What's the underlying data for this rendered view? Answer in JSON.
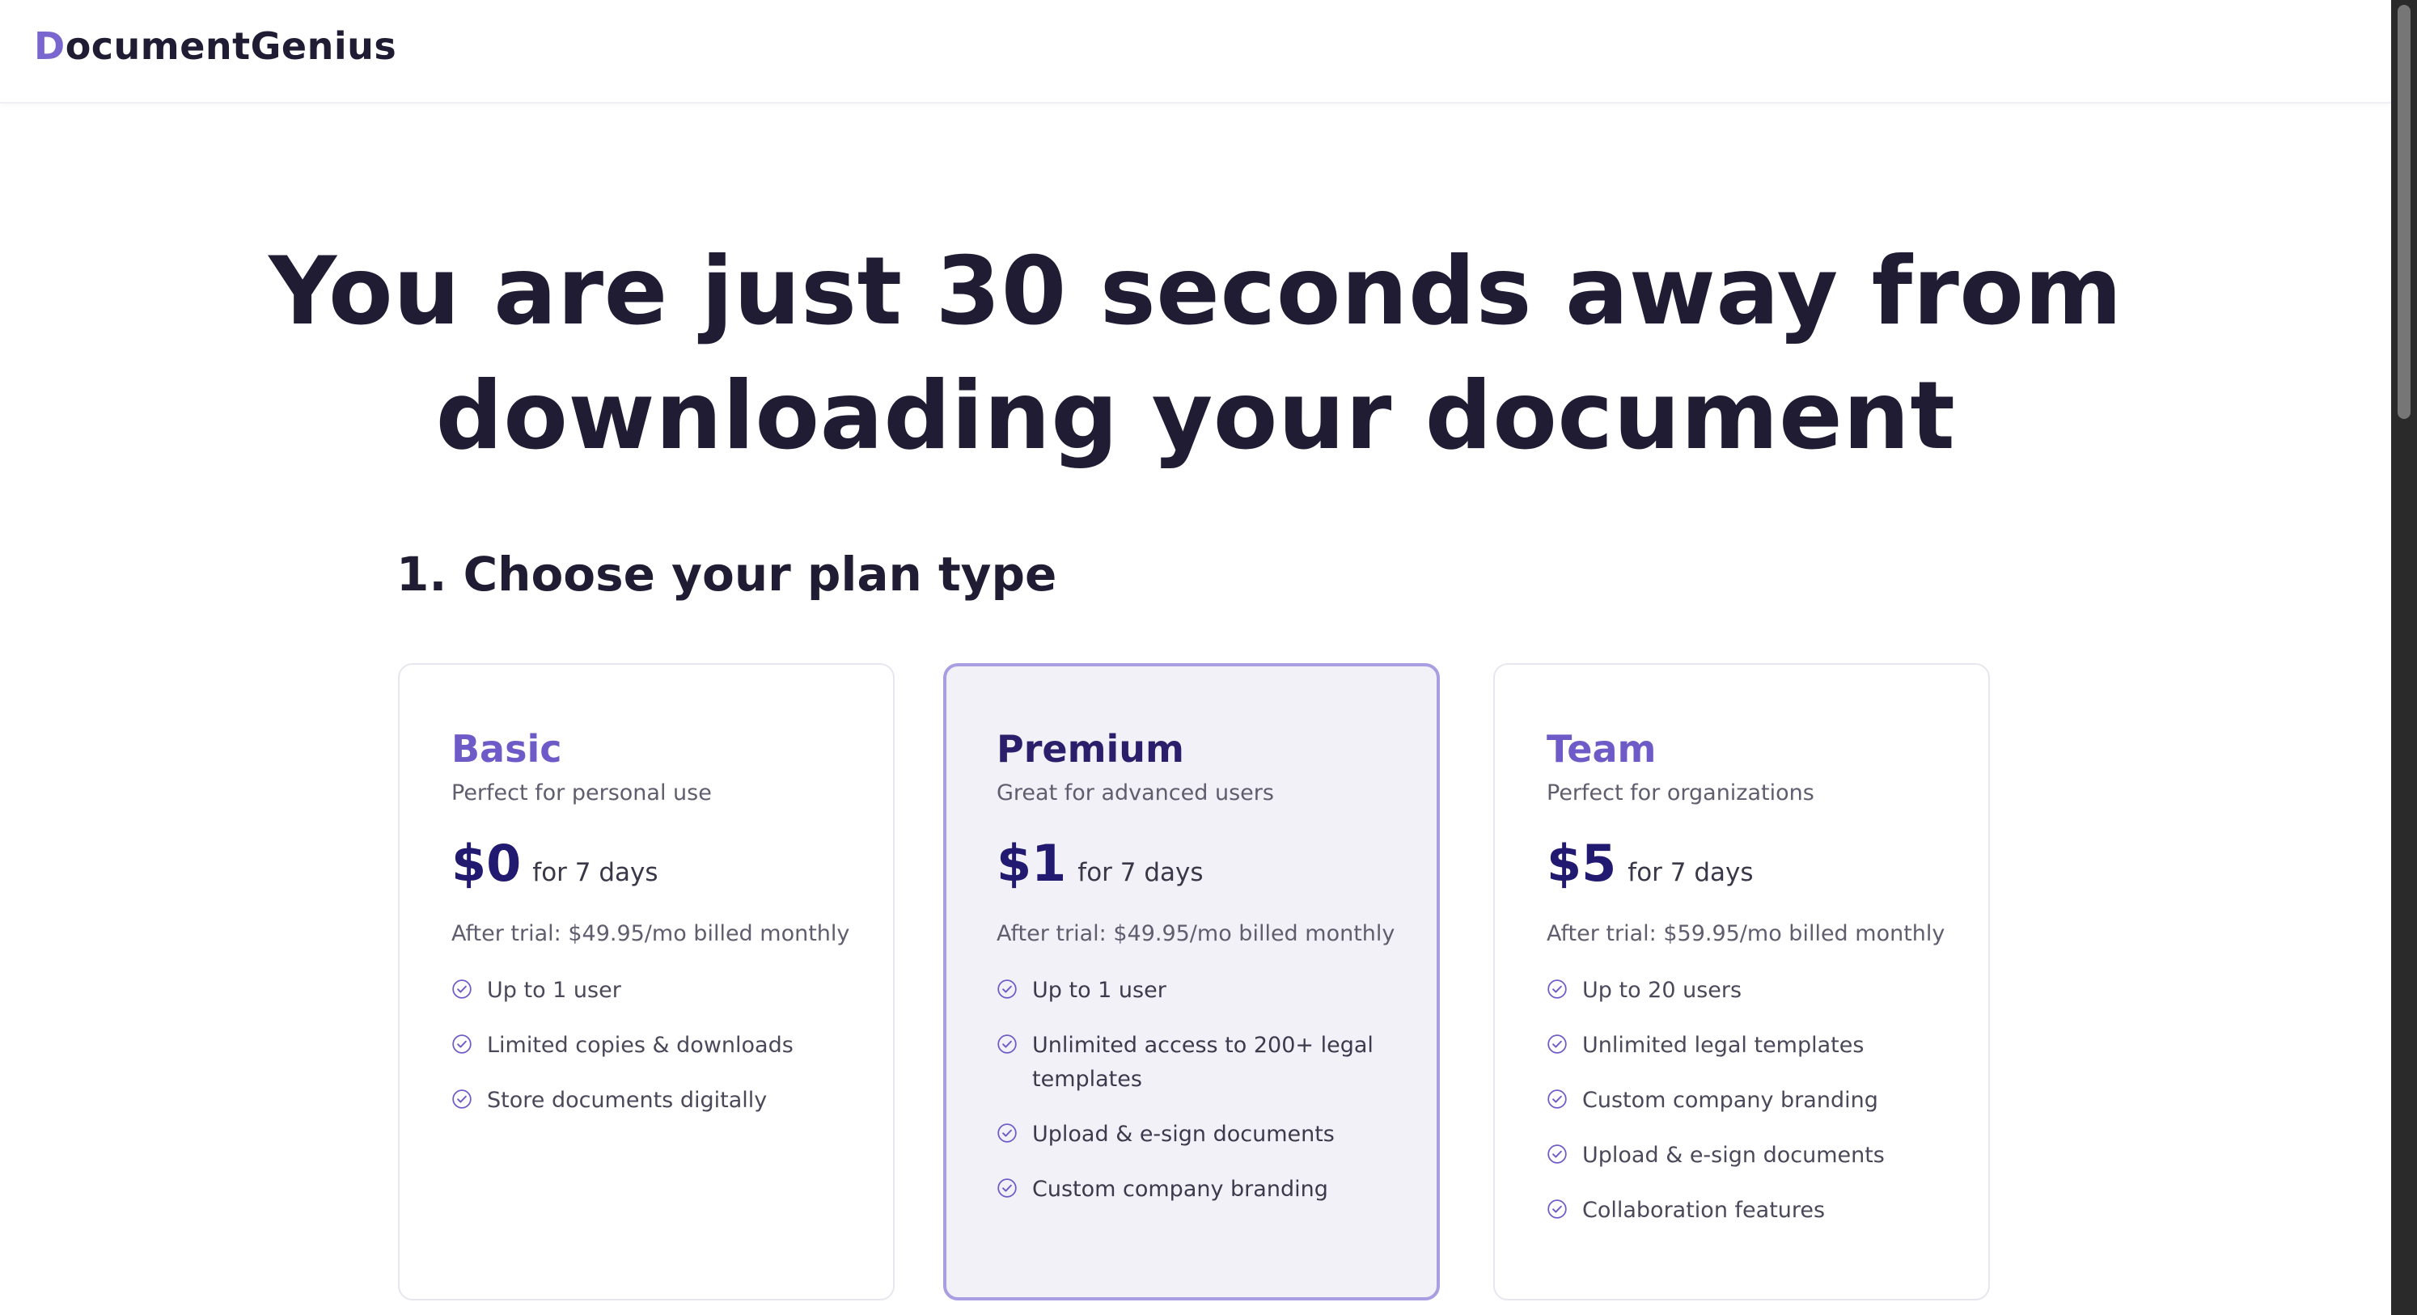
{
  "header": {
    "logo_initial": "D",
    "logo_rest": "ocumentGenius"
  },
  "hero": {
    "line1": "You are just 30 seconds away from",
    "line2": "downloading your document"
  },
  "section": {
    "title": "1. Choose your plan type"
  },
  "colors": {
    "accent": "#6e5bc8",
    "price": "#221a70",
    "selected_border": "#a99ee2",
    "selected_bg": "#f2f1f8"
  },
  "plans": [
    {
      "name": "Basic",
      "tagline": "Perfect for personal use",
      "price": "$0",
      "period": "for 7 days",
      "after_trial": "After trial: $49.95/mo billed monthly",
      "selected": false,
      "features": [
        "Up to 1 user",
        "Limited copies & downloads",
        "Store documents digitally"
      ]
    },
    {
      "name": "Premium",
      "tagline": "Great for advanced users",
      "price": "$1",
      "period": "for 7 days",
      "after_trial": "After trial: $49.95/mo billed monthly",
      "selected": true,
      "features": [
        "Up to 1 user",
        "Unlimited access to 200+ legal templates",
        "Upload & e-sign documents",
        "Custom company branding"
      ]
    },
    {
      "name": "Team",
      "tagline": "Perfect for organizations",
      "price": "$5",
      "period": "for 7 days",
      "after_trial": "After trial: $59.95/mo billed monthly",
      "selected": false,
      "features": [
        "Up to 20 users",
        "Unlimited legal templates",
        "Custom company branding",
        "Upload & e-sign documents",
        "Collaboration features"
      ]
    }
  ]
}
